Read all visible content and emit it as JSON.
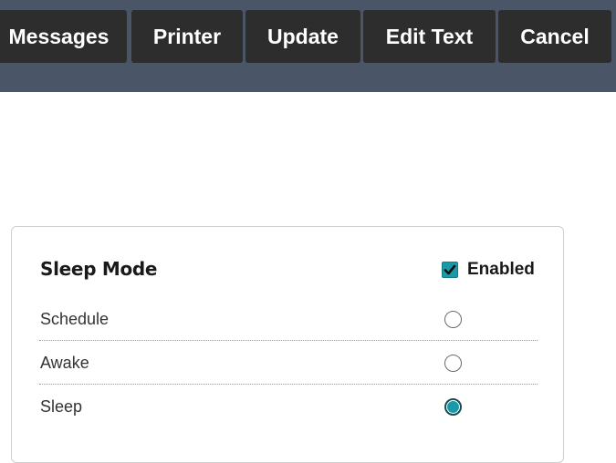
{
  "toolbar": {
    "buttons": [
      {
        "label": "Messages"
      },
      {
        "label": "Printer"
      },
      {
        "label": "Update"
      },
      {
        "label": "Edit Text"
      },
      {
        "label": "Cancel"
      }
    ]
  },
  "sleep_mode": {
    "title": "Sleep Mode",
    "enabled_label": "Enabled",
    "enabled_checked": true,
    "options": [
      {
        "label": "Schedule",
        "selected": false
      },
      {
        "label": "Awake",
        "selected": false
      },
      {
        "label": "Sleep",
        "selected": true
      }
    ]
  },
  "colors": {
    "toolbar_bg": "#4a5568",
    "button_bg": "#2d2d2d",
    "accent": "#1a9aa8"
  },
  "icons": {
    "checkbox": "check-icon"
  }
}
